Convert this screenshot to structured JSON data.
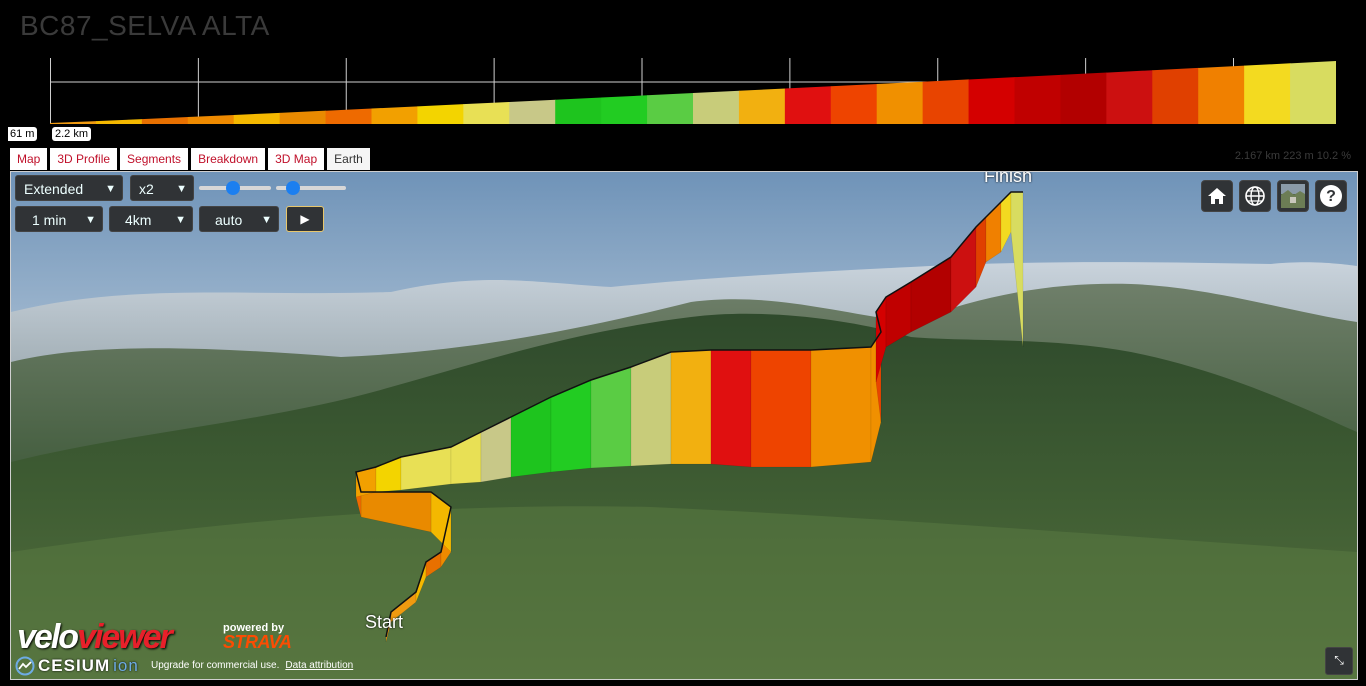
{
  "title": "BC87_SELVA ALTA",
  "profile": {
    "chips": [
      "61 m",
      "2.2 km"
    ],
    "colors": [
      "#f09a10",
      "#f4b800",
      "#e87000",
      "#ee8a00",
      "#f4b800",
      "#e98a00",
      "#ee6a00",
      "#f2a000",
      "#f3d400",
      "#e8e055",
      "#c8c888",
      "#1ec41e",
      "#22cc22",
      "#5acc44",
      "#c8cc7a",
      "#f2b010",
      "#e01010",
      "#ee4400",
      "#f09000",
      "#e84400",
      "#d40000",
      "#c00000",
      "#b20000",
      "#cc1010",
      "#e04000",
      "#f08000",
      "#f3da20",
      "#d8dc60"
    ]
  },
  "tabs": [
    "Map",
    "3D Profile",
    "Segments",
    "Breakdown",
    "3D Map",
    "Earth"
  ],
  "active_tab": "Earth",
  "stats": "2.167 km 223 m 10.2 %",
  "controls": {
    "view_mode": "Extended",
    "exaggeration": "x2",
    "duration": "1 min",
    "distance": "4km",
    "camera": "auto",
    "play": "▶"
  },
  "map_labels": {
    "start": "Start",
    "finish": "Finish"
  },
  "toolbar_icons": [
    "home-icon",
    "globe-icon",
    "imagery-icon",
    "help-icon"
  ],
  "branding": {
    "velo": "velo",
    "viewer": "viewer",
    "powered_by": "powered by",
    "strava": "STRAVA",
    "cesium": "CESIUM",
    "ion": "ion",
    "upgrade": "Upgrade for commercial use.",
    "attribution": "Data attribution"
  }
}
